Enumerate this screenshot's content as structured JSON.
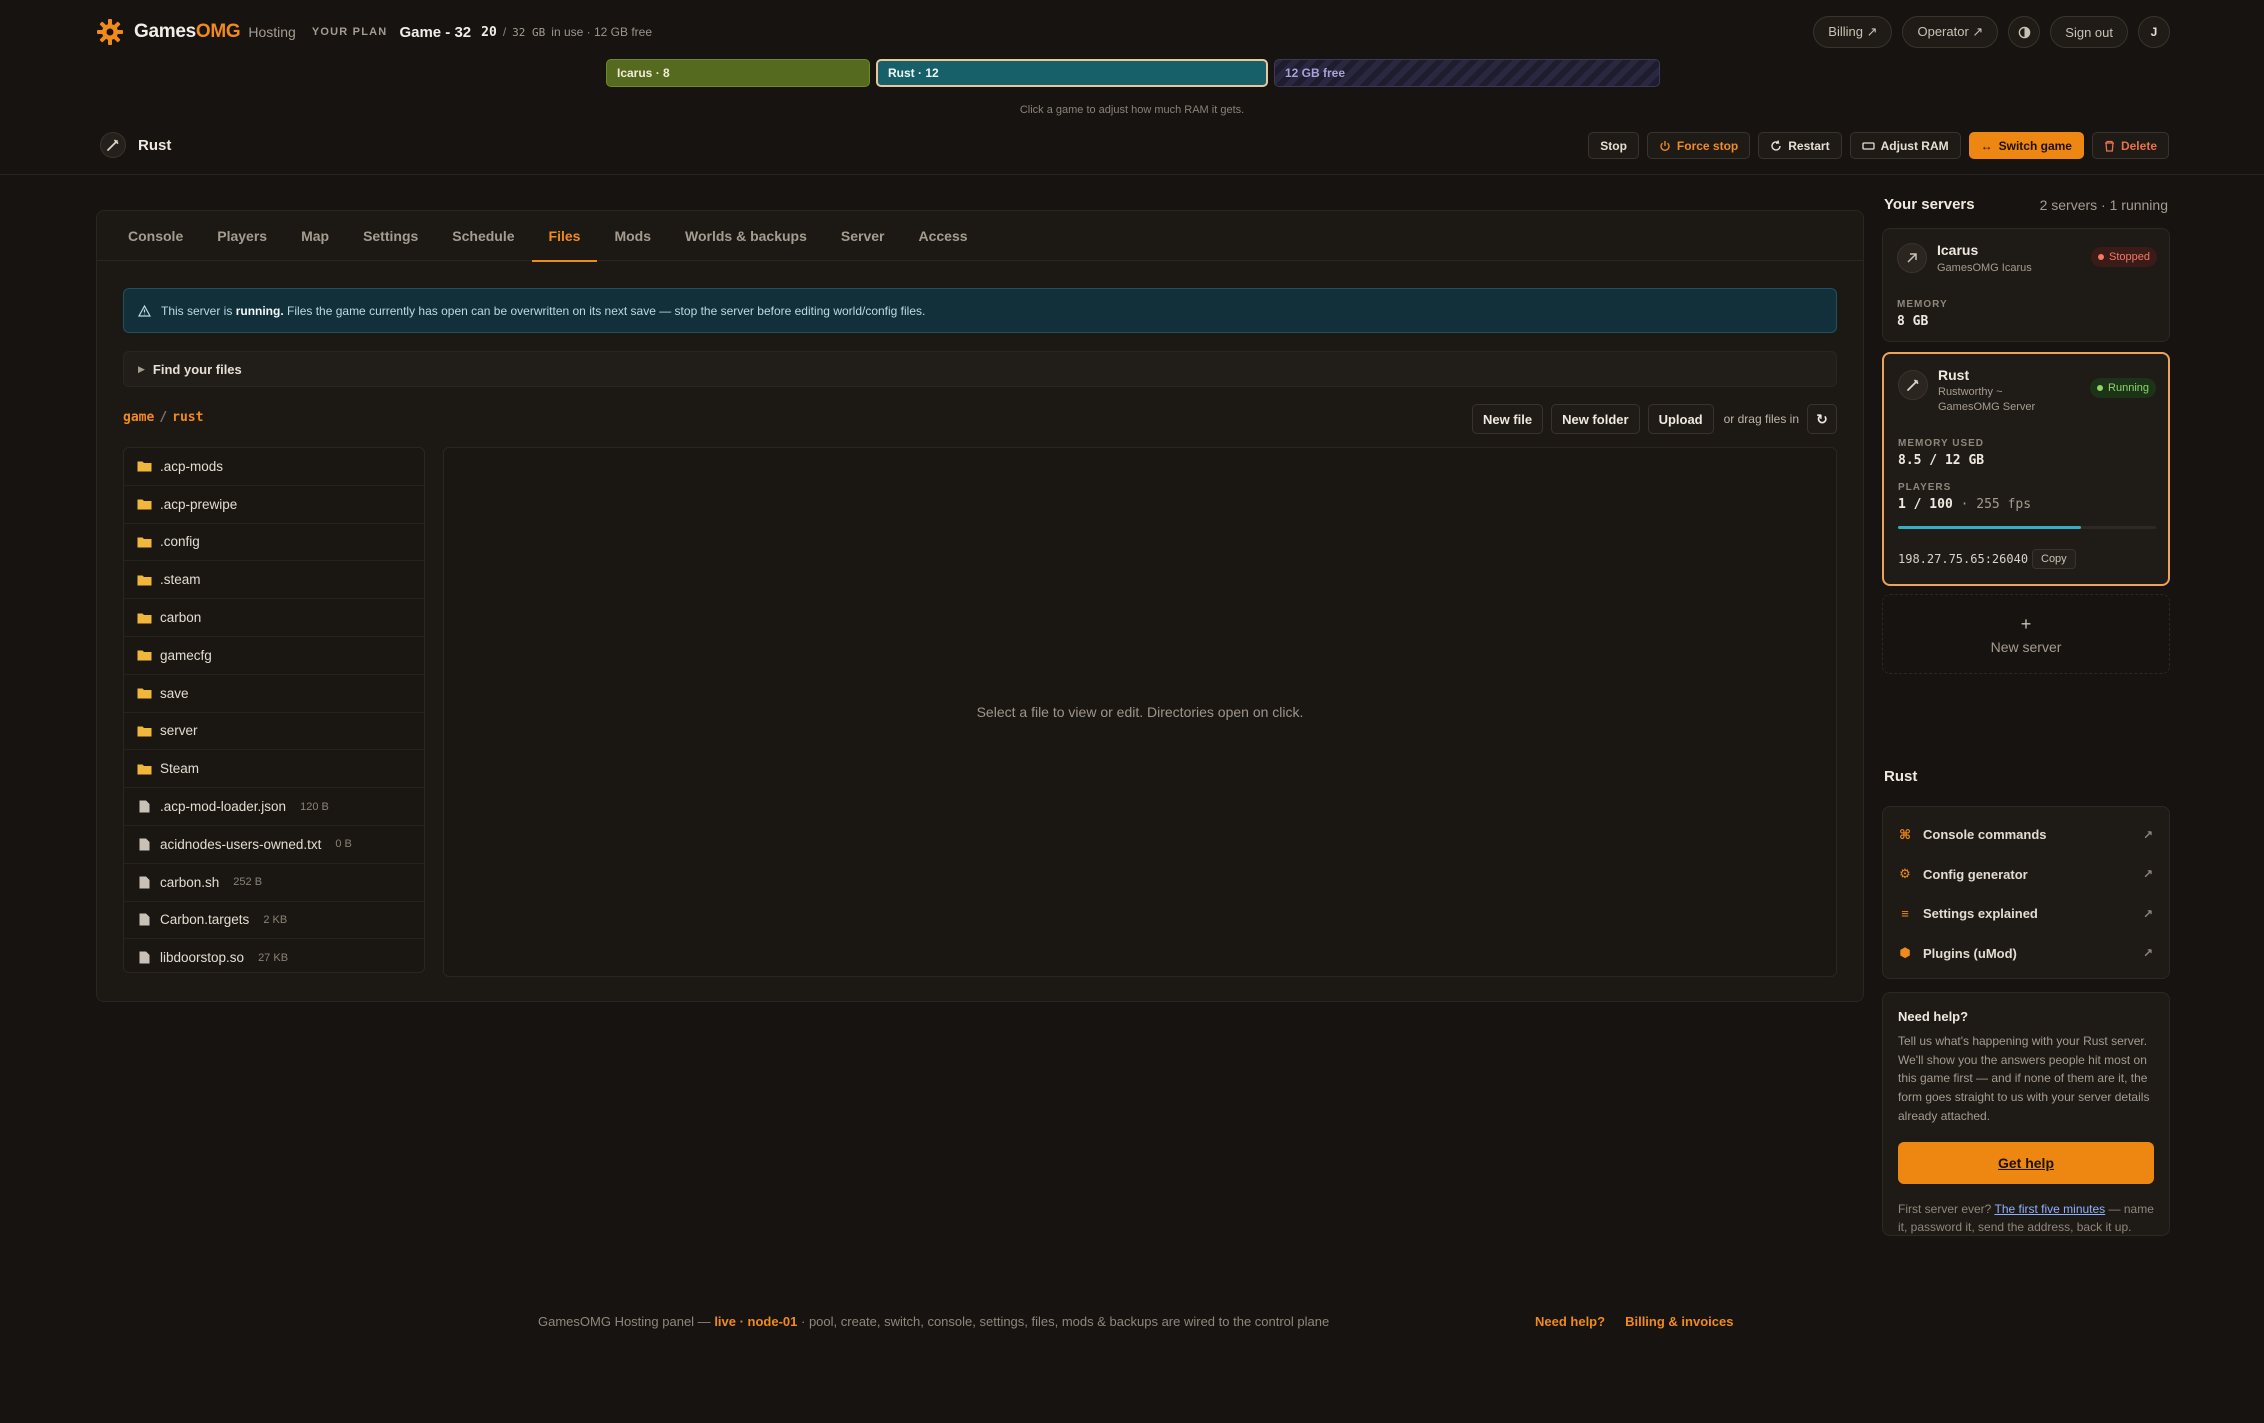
{
  "header": {
    "brand": "Games",
    "brand_accent": "OMG",
    "brand_sub": "Hosting",
    "plan_label": "YOUR PLAN",
    "plan_name": "Game - 32",
    "plan_used": "20",
    "plan_sep": "/",
    "plan_total": "32 GB",
    "plan_note": "in use · 12 GB free",
    "billing_label": "Billing ↗",
    "operator_label": "Operator ↗",
    "theme_icon": "half-circle-icon",
    "signout_label": "Sign out",
    "avatar_initial": "J"
  },
  "ram_bar": {
    "segments": [
      {
        "label": "Icarus · 8",
        "gb": 8
      },
      {
        "label": "Rust · 12",
        "gb": 12
      },
      {
        "label": "12 GB free",
        "gb": 12
      }
    ],
    "hint": "Click a game to adjust how much RAM it gets."
  },
  "server": {
    "title": "Rust",
    "actions": {
      "stop": "Stop",
      "force_stop": "Force stop",
      "restart": "Restart",
      "adjust_ram": "Adjust RAM",
      "switch_game": "Switch game",
      "delete": "Delete"
    }
  },
  "tabs": [
    "Console",
    "Players",
    "Map",
    "Settings",
    "Schedule",
    "Files",
    "Mods",
    "Worlds & backups",
    "Server",
    "Access"
  ],
  "active_tab": "Files",
  "alert": {
    "prefix": "This server is",
    "status": "running.",
    "text": "Files the game currently has open can be overwritten on its next save — stop the server before editing world/config files."
  },
  "find_files_label": "Find your files",
  "breadcrumb": [
    "game",
    "rust"
  ],
  "file_actions": {
    "new_file": "New file",
    "new_folder": "New folder",
    "upload": "Upload",
    "drag_note": "or drag files in",
    "refresh_icon": "↻"
  },
  "files": [
    {
      "name": ".acp-mods",
      "type": "folder",
      "size": ""
    },
    {
      "name": ".acp-prewipe",
      "type": "folder",
      "size": ""
    },
    {
      "name": ".config",
      "type": "folder",
      "size": ""
    },
    {
      "name": ".steam",
      "type": "folder",
      "size": ""
    },
    {
      "name": "carbon",
      "type": "folder",
      "size": ""
    },
    {
      "name": "gamecfg",
      "type": "folder",
      "size": ""
    },
    {
      "name": "save",
      "type": "folder",
      "size": ""
    },
    {
      "name": "server",
      "type": "folder",
      "size": ""
    },
    {
      "name": "Steam",
      "type": "folder",
      "size": ""
    },
    {
      "name": ".acp-mod-loader.json",
      "type": "file",
      "size": "120 B"
    },
    {
      "name": "acidnodes-users-owned.txt",
      "type": "file",
      "size": "0 B"
    },
    {
      "name": "carbon.sh",
      "type": "file",
      "size": "252 B"
    },
    {
      "name": "Carbon.targets",
      "type": "file",
      "size": "2 KB"
    },
    {
      "name": "libdoorstop.so",
      "type": "file",
      "size": "27 KB"
    }
  ],
  "editor_placeholder": "Select a file to view or edit. Directories open on click.",
  "sidebar": {
    "title": "Your servers",
    "meta": "2 servers · 1 running",
    "servers": [
      {
        "name": "Icarus",
        "sub": "GamesOMG Icarus",
        "status": "Stopped",
        "memory_label": "MEMORY",
        "memory_value": "8 GB"
      },
      {
        "name": "Rust",
        "sub_line1": "Rustworthy ~",
        "sub_line2": "GamesOMG Server",
        "status": "Running",
        "memory_label": "MEMORY USED",
        "memory_value": "8.5 / 12 GB",
        "players_label": "PLAYERS",
        "players_value": "1 / 100",
        "fps_value": "· 255 fps",
        "memory_fraction": 0.71,
        "address": "198.27.75.65:26040",
        "copy_label": "Copy"
      }
    ],
    "new_server_plus": "+",
    "new_server_label": "New server"
  },
  "game_section": {
    "title": "Rust",
    "links": [
      {
        "label": "Console commands",
        "icon": "⌘"
      },
      {
        "label": "Config generator",
        "icon": "⚙"
      },
      {
        "label": "Settings explained",
        "icon": "≡"
      },
      {
        "label": "Plugins (uMod)",
        "icon": "⬢"
      }
    ],
    "arrow": "↗"
  },
  "help": {
    "title": "Need help?",
    "body": "Tell us what's happening with your Rust server. We'll show you the answers people hit most on this game first — and if none of them are it, the form goes straight to us with your server details already attached.",
    "button": "Get help",
    "foot_prefix": "First server ever?",
    "foot_link": "The first five minutes",
    "foot_suffix": "— name it, password it, send the address, back it up."
  },
  "footer": {
    "prefix": "GamesOMG Hosting panel —",
    "live": "live · node-01",
    "suffix": "· pool, create, switch, console, settings, files, mods & backups are wired to the control plane",
    "link_help": "Need help?",
    "link_billing": "Billing & invoices"
  },
  "colors": {
    "accent": "#f08a1c",
    "running": "#8fd46b",
    "stopped": "#ef7b64",
    "info": "#11303a"
  }
}
